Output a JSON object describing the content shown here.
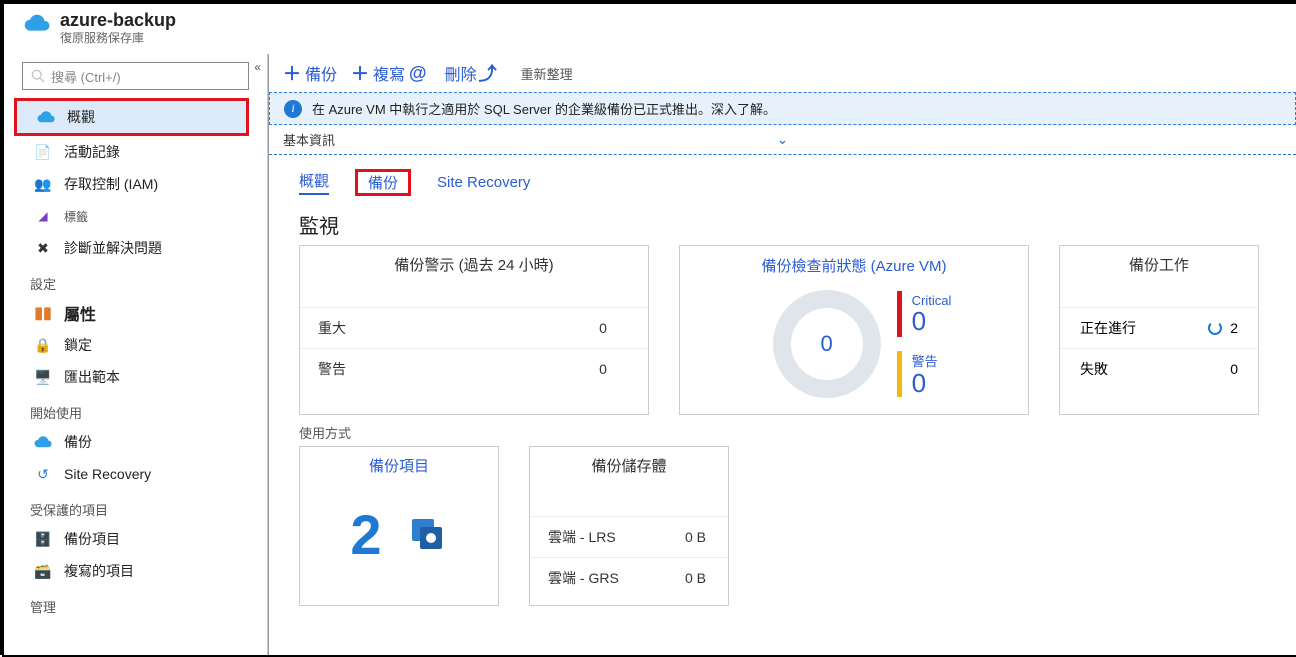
{
  "header": {
    "title": "azure-backup",
    "subtitle": "復原服務保存庫"
  },
  "search": {
    "placeholder": "搜尋 (Ctrl+/)"
  },
  "nav": {
    "overview": "概觀",
    "activity": "活動記錄",
    "iam": "存取控制 (IAM)",
    "tags": "標籤",
    "diagnose": "診斷並解決問題",
    "sec_settings": "設定",
    "properties": "屬性",
    "locks": "鎖定",
    "export": "匯出範本",
    "sec_start": "開始使用",
    "backup": "備份",
    "site_recovery": "Site Recovery",
    "sec_protected": "受保護的項目",
    "backup_items": "備份項目",
    "replicated": "複寫的項目",
    "sec_manage": "管理"
  },
  "toolbar": {
    "backup": "備份",
    "replicate": "複寫",
    "delete": "刪除",
    "refresh": "重新整理"
  },
  "banner": {
    "text": "在 Azure VM 中執行之適用於 SQL Server 的企業級備份已正式推出。深入了解。"
  },
  "essentials": {
    "label": "基本資訊"
  },
  "tabs": {
    "overview": "概觀",
    "backup": "備份",
    "sr": "Site Recovery"
  },
  "monitor": {
    "heading": "監視",
    "alerts": {
      "title": "備份警示 (過去 24 小時)",
      "rows": [
        {
          "k": "重大",
          "v": "0"
        },
        {
          "k": "警告",
          "v": "0"
        }
      ]
    },
    "prechk": {
      "title": "備份檢查前狀態 (Azure VM)",
      "center": "0",
      "critical_k": "Critical",
      "critical_v": "0",
      "warning_k": "警告",
      "warning_v": "0"
    },
    "jobs": {
      "title": "備份工作",
      "rows": [
        {
          "k": "正在進行",
          "v": "2"
        },
        {
          "k": "失敗",
          "v": "0"
        }
      ]
    }
  },
  "usage": {
    "heading": "使用方式",
    "items": {
      "title": "備份項目",
      "count": "2"
    },
    "storage": {
      "title": "備份儲存體",
      "rows": [
        {
          "k": "雲端 - LRS",
          "v": "0 B"
        },
        {
          "k": "雲端 - GRS",
          "v": "0 B"
        }
      ]
    }
  }
}
